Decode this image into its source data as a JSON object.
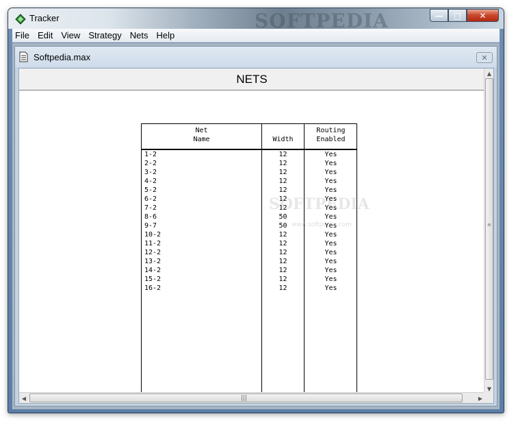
{
  "app": {
    "title": "Tracker",
    "title_watermark": "SOFTPEDIA"
  },
  "menu": {
    "items": [
      "File",
      "Edit",
      "View",
      "Strategy",
      "Nets",
      "Help"
    ]
  },
  "document": {
    "title": "Softpedia.max",
    "heading": "NETS"
  },
  "table": {
    "headers": {
      "net_name": "Net\nName",
      "width": "Width",
      "routing": "Routing\nEnabled"
    },
    "rows": [
      {
        "name": "1-2",
        "width": "12",
        "routing": "Yes"
      },
      {
        "name": "2-2",
        "width": "12",
        "routing": "Yes"
      },
      {
        "name": "3-2",
        "width": "12",
        "routing": "Yes"
      },
      {
        "name": "4-2",
        "width": "12",
        "routing": "Yes"
      },
      {
        "name": "5-2",
        "width": "12",
        "routing": "Yes"
      },
      {
        "name": "6-2",
        "width": "12",
        "routing": "Yes"
      },
      {
        "name": "7-2",
        "width": "12",
        "routing": "Yes"
      },
      {
        "name": "8-6",
        "width": "50",
        "routing": "Yes"
      },
      {
        "name": "9-7",
        "width": "50",
        "routing": "Yes"
      },
      {
        "name": "10-2",
        "width": "12",
        "routing": "Yes"
      },
      {
        "name": "11-2",
        "width": "12",
        "routing": "Yes"
      },
      {
        "name": "12-2",
        "width": "12",
        "routing": "Yes"
      },
      {
        "name": "13-2",
        "width": "12",
        "routing": "Yes"
      },
      {
        "name": "14-2",
        "width": "12",
        "routing": "Yes"
      },
      {
        "name": "15-2",
        "width": "12",
        "routing": "Yes"
      },
      {
        "name": "16-2",
        "width": "12",
        "routing": "Yes"
      }
    ]
  },
  "watermark": {
    "main": "SOFTPEDIA",
    "sub": "www.softpedia.com"
  },
  "icons": {
    "app": "tracker-app-icon",
    "doc": "document-icon",
    "close": "close-icon"
  }
}
